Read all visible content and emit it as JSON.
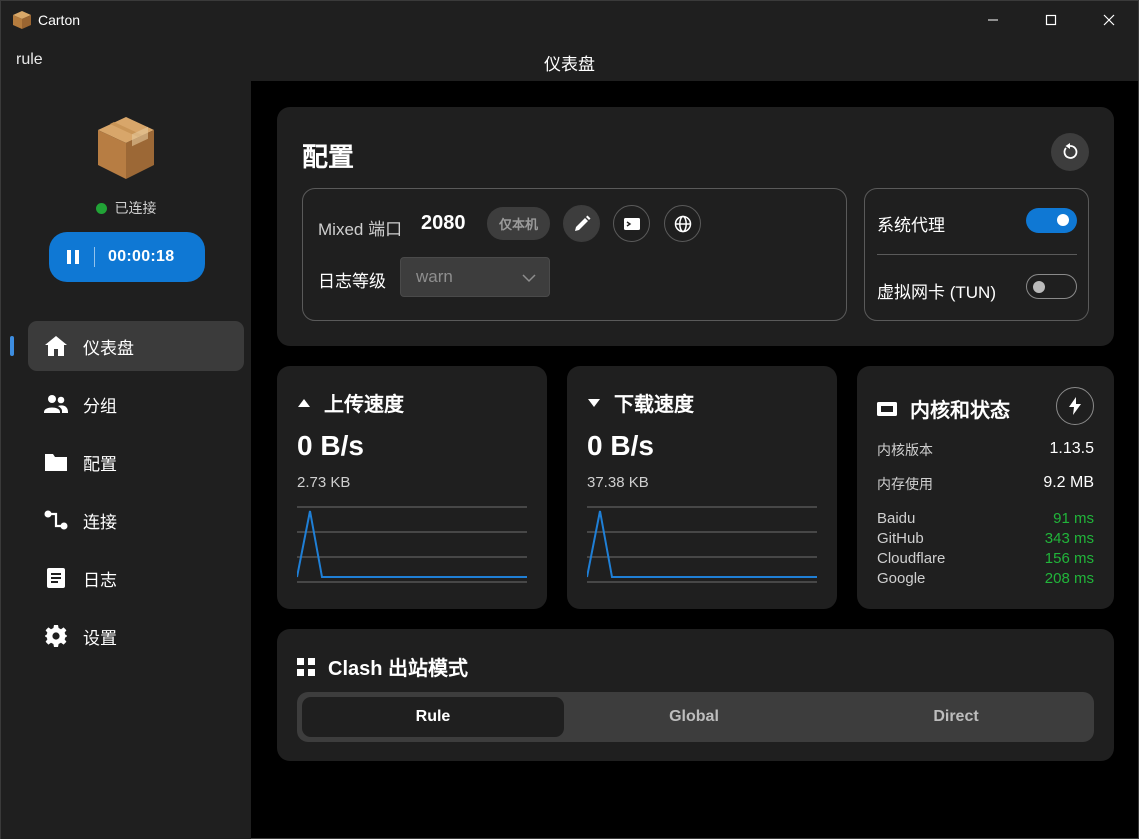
{
  "window": {
    "app_title": "Carton"
  },
  "header": {
    "left_text": "rule",
    "title": "仪表盘"
  },
  "sidebar": {
    "status": "已连接",
    "timer": "00:00:18",
    "items": [
      {
        "label": "仪表盘",
        "icon": "home-icon",
        "active": true
      },
      {
        "label": "分组",
        "icon": "people-icon",
        "active": false
      },
      {
        "label": "配置",
        "icon": "folder-icon",
        "active": false
      },
      {
        "label": "连接",
        "icon": "connection-icon",
        "active": false
      },
      {
        "label": "日志",
        "icon": "document-icon",
        "active": false
      },
      {
        "label": "设置",
        "icon": "gear-icon",
        "active": false
      }
    ]
  },
  "config": {
    "title": "配置",
    "mixed_port_label": "Mixed 端口",
    "mixed_port_value": "2080",
    "local_badge": "仅本机",
    "log_level_label": "日志等级",
    "log_level_value": "warn",
    "system_proxy_label": "系统代理",
    "system_proxy_on": true,
    "tun_label": "虚拟网卡 (TUN)",
    "tun_on": false
  },
  "upload": {
    "title": "上传速度",
    "speed": "0 B/s",
    "total": "2.73 KB"
  },
  "download": {
    "title": "下载速度",
    "speed": "0 B/s",
    "total": "37.38 KB"
  },
  "core": {
    "title": "内核和状态",
    "version_label": "内核版本",
    "version_value": "1.13.5",
    "memory_label": "内存使用",
    "memory_value": "9.2 MB",
    "latency": [
      {
        "name": "Baidu",
        "value": "91 ms"
      },
      {
        "name": "GitHub",
        "value": "343 ms"
      },
      {
        "name": "Cloudflare",
        "value": "156 ms"
      },
      {
        "name": "Google",
        "value": "208 ms"
      }
    ]
  },
  "mode": {
    "title": "Clash 出站模式",
    "options": [
      "Rule",
      "Global",
      "Direct"
    ],
    "selected": "Rule"
  },
  "colors": {
    "accent": "#0f78d4",
    "success": "#21b53a",
    "card": "#1f1f1f"
  }
}
